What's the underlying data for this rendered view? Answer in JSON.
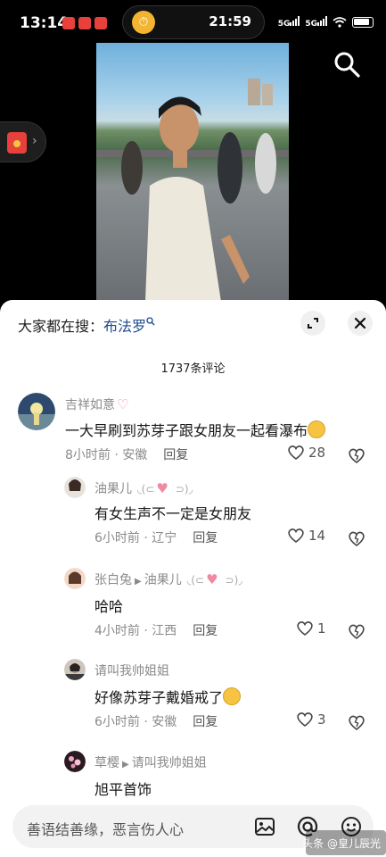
{
  "status_bar": {
    "time": "13:14",
    "island_time": "21:59",
    "network": [
      "5G",
      "5G"
    ]
  },
  "top": {
    "search_icon": "search-icon"
  },
  "sheet": {
    "trending_prefix": "大家都在搜：",
    "trending_term": "布法罗",
    "comment_count": "1737条评论"
  },
  "comments": [
    {
      "user": "吉祥如意",
      "text": "一大早刷到苏芽子跟女朋友一起看瀑布",
      "time": "8小时前 · 安徽",
      "reply": "回复",
      "likes": "28"
    },
    {
      "user": "油果儿",
      "text": "有女生声不一定是女朋友",
      "time": "6小时前 · 辽宁",
      "reply": "回复",
      "likes": "14"
    },
    {
      "user": "张白兔",
      "reply_to": "油果儿",
      "text": "哈哈",
      "time": "4小时前 · 江西",
      "reply": "回复",
      "likes": "1"
    },
    {
      "user": "请叫我帅姐姐",
      "text": "好像苏芽子戴婚戒了",
      "time": "6小时前 · 安徽",
      "reply": "回复",
      "likes": "3"
    },
    {
      "user": "草樱",
      "reply_to": "请叫我帅姐姐",
      "text": "旭平首饰"
    }
  ],
  "input": {
    "placeholder": "善语结善缘，恶言伤人心"
  },
  "watermark": "头条 @皇儿辰光",
  "colors": {
    "accent": "#1a4a8f",
    "meta": "#8a8a8a",
    "sheet": "#ffffff"
  }
}
